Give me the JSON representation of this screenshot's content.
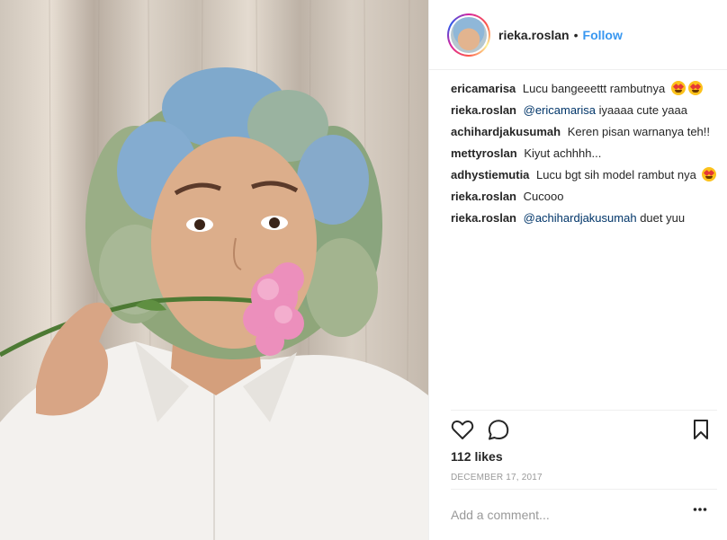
{
  "header": {
    "username": "rieka.roslan",
    "separator": "•",
    "follow_label": "Follow"
  },
  "comments": [
    {
      "user": "ericamarisa",
      "mention": "",
      "text": "Lucu bangeeettt rambutnya",
      "emoji_count": 2
    },
    {
      "user": "rieka.roslan",
      "mention": "@ericamarisa",
      "text": "iyaaaa cute yaaa",
      "emoji_count": 0
    },
    {
      "user": "achihardjakusumah",
      "mention": "",
      "text": "Keren pisan warnanya teh!!",
      "emoji_count": 0
    },
    {
      "user": "mettyroslan",
      "mention": "",
      "text": "Kiyut achhhh...",
      "emoji_count": 0
    },
    {
      "user": "adhystiemutia",
      "mention": "",
      "text": "Lucu bgt sih model rambut nya",
      "emoji_count": 1
    },
    {
      "user": "rieka.roslan",
      "mention": "",
      "text": "Cucooo",
      "emoji_count": 0
    },
    {
      "user": "rieka.roslan",
      "mention": "@achihardjakusumah",
      "text": "duet yuu",
      "emoji_count": 0
    }
  ],
  "actions": {
    "like_icon": "heart-outline-icon",
    "comment_icon": "comment-bubble-icon",
    "save_icon": "bookmark-icon"
  },
  "likes": "112 likes",
  "date": "DECEMBER 17, 2017",
  "add_comment": {
    "placeholder": "Add a comment...",
    "more_icon": "ellipsis-icon"
  },
  "colors": {
    "accent": "#3897f0",
    "text": "#262626",
    "muted": "#999999",
    "divider": "#efefef"
  }
}
